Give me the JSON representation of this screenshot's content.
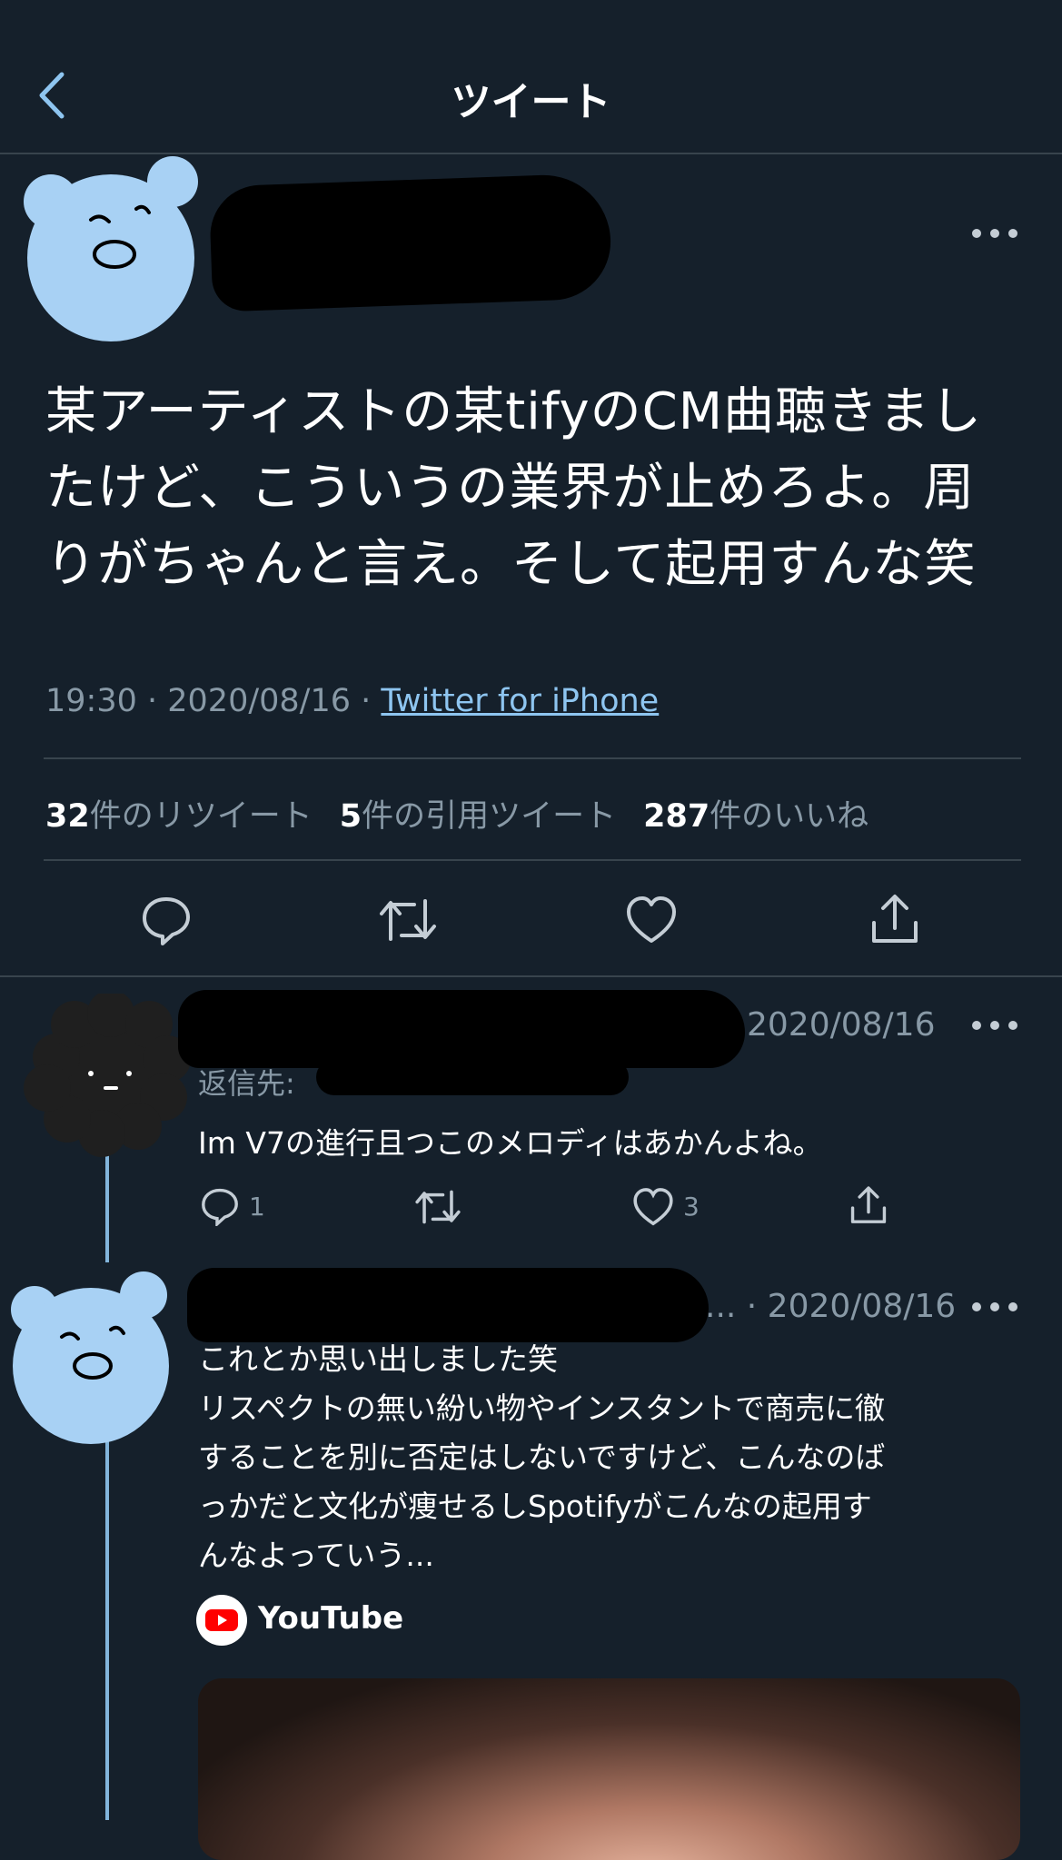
{
  "header": {
    "title": "ツイート"
  },
  "tweet": {
    "body_lines": [
      "某アーティストの某tifyのCM曲聴きまし",
      "たけど、こういうの業界が止めろよ。周",
      "りがちゃんと言え。そして起用すんな笑"
    ],
    "time": "19:30",
    "date": "2020/08/16",
    "separator": " · ",
    "source": "Twitter for iPhone",
    "stats": {
      "retweets_count": "32",
      "retweets_label": "件のリツイート",
      "quotes_count": "5",
      "quotes_label": "件の引用ツイート",
      "likes_count": "287",
      "likes_label": "件のいいね"
    }
  },
  "replies": [
    {
      "date": "2020/08/16",
      "reply_to_label": "返信先:",
      "text": "Im V7の進行且つこのメロディはあかんよね。",
      "reply_count": "1",
      "like_count": "3"
    },
    {
      "date_prefix": "... · ",
      "date": "2020/08/16",
      "text_lines": [
        "これとか思い出しました笑",
        "リスペクトの無い紛い物やインスタントで商売に徹",
        "することを別に否定はしないですけど、こんなのば",
        "っかだと文化が痩せるしSpotifyがこんなの起用す",
        "んなよっていう..."
      ],
      "card_source": "YouTube"
    }
  ],
  "colors": {
    "background": "#15202b",
    "divider": "#38444d",
    "accent": "#8ec5f0",
    "muted": "#8899a6",
    "avatar_bear": "#a8d1f4"
  },
  "icons": [
    "back-chevron-icon",
    "more-icon",
    "reply-icon",
    "retweet-icon",
    "like-icon",
    "share-icon",
    "youtube-icon"
  ]
}
